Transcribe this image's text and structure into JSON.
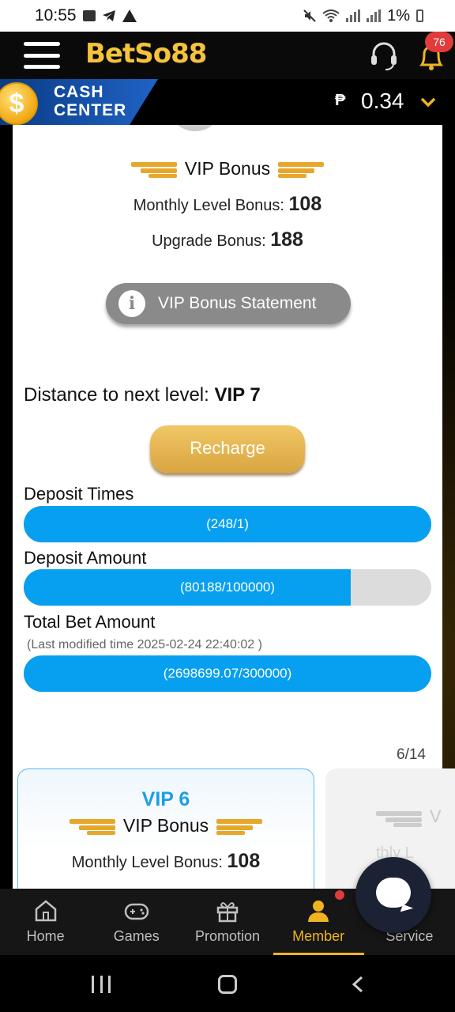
{
  "status_bar": {
    "time": "10:55",
    "battery": "1%"
  },
  "header": {
    "logo_text": "BetSo88",
    "notification_count": "76"
  },
  "cash": {
    "label_line1": "CASH",
    "label_line2": "CENTER",
    "currency_symbol": "₱",
    "balance": "0.34",
    "coin_symbol": "$"
  },
  "vip_bonus": {
    "title": "VIP Bonus",
    "monthly_label": "Monthly Level Bonus:",
    "monthly_value": "108",
    "upgrade_label": "Upgrade Bonus:",
    "upgrade_value": "188",
    "statement_button": "VIP Bonus Statement"
  },
  "next_level": {
    "label": "Distance to next level:",
    "level": "VIP 7",
    "recharge_button": "Recharge"
  },
  "metrics": [
    {
      "label": "Deposit Times",
      "text": "(248/1)",
      "progress": 1.0
    },
    {
      "label": "Deposit Amount",
      "text": "(80188/100000)",
      "progress": 0.80188
    },
    {
      "label": "Total Bet Amount",
      "text": "(2698699.07/300000)",
      "progress": 1.0
    }
  ],
  "modified_note": "(Last modified time 2025-02-24 22:40:02 )",
  "pager": {
    "indicator": "6/14"
  },
  "vip_card": {
    "level": "VIP 6",
    "title": "VIP Bonus",
    "monthly_label": "Monthly Level Bonus:",
    "monthly_value": "108"
  },
  "vip_card_next": {
    "partial_title": "V",
    "partial_bonus": "thly L"
  },
  "bottom_nav": [
    {
      "label": "Home",
      "icon": "home-icon"
    },
    {
      "label": "Games",
      "icon": "gamepad-icon"
    },
    {
      "label": "Promotion",
      "icon": "gift-icon"
    },
    {
      "label": "Member",
      "icon": "member-icon",
      "active": true
    },
    {
      "label": "Service",
      "icon": "service-icon"
    }
  ],
  "colors": {
    "accent_gold": "#f0b320",
    "progress_blue": "#079ff0",
    "vip_level_blue": "#1b9ee6"
  }
}
